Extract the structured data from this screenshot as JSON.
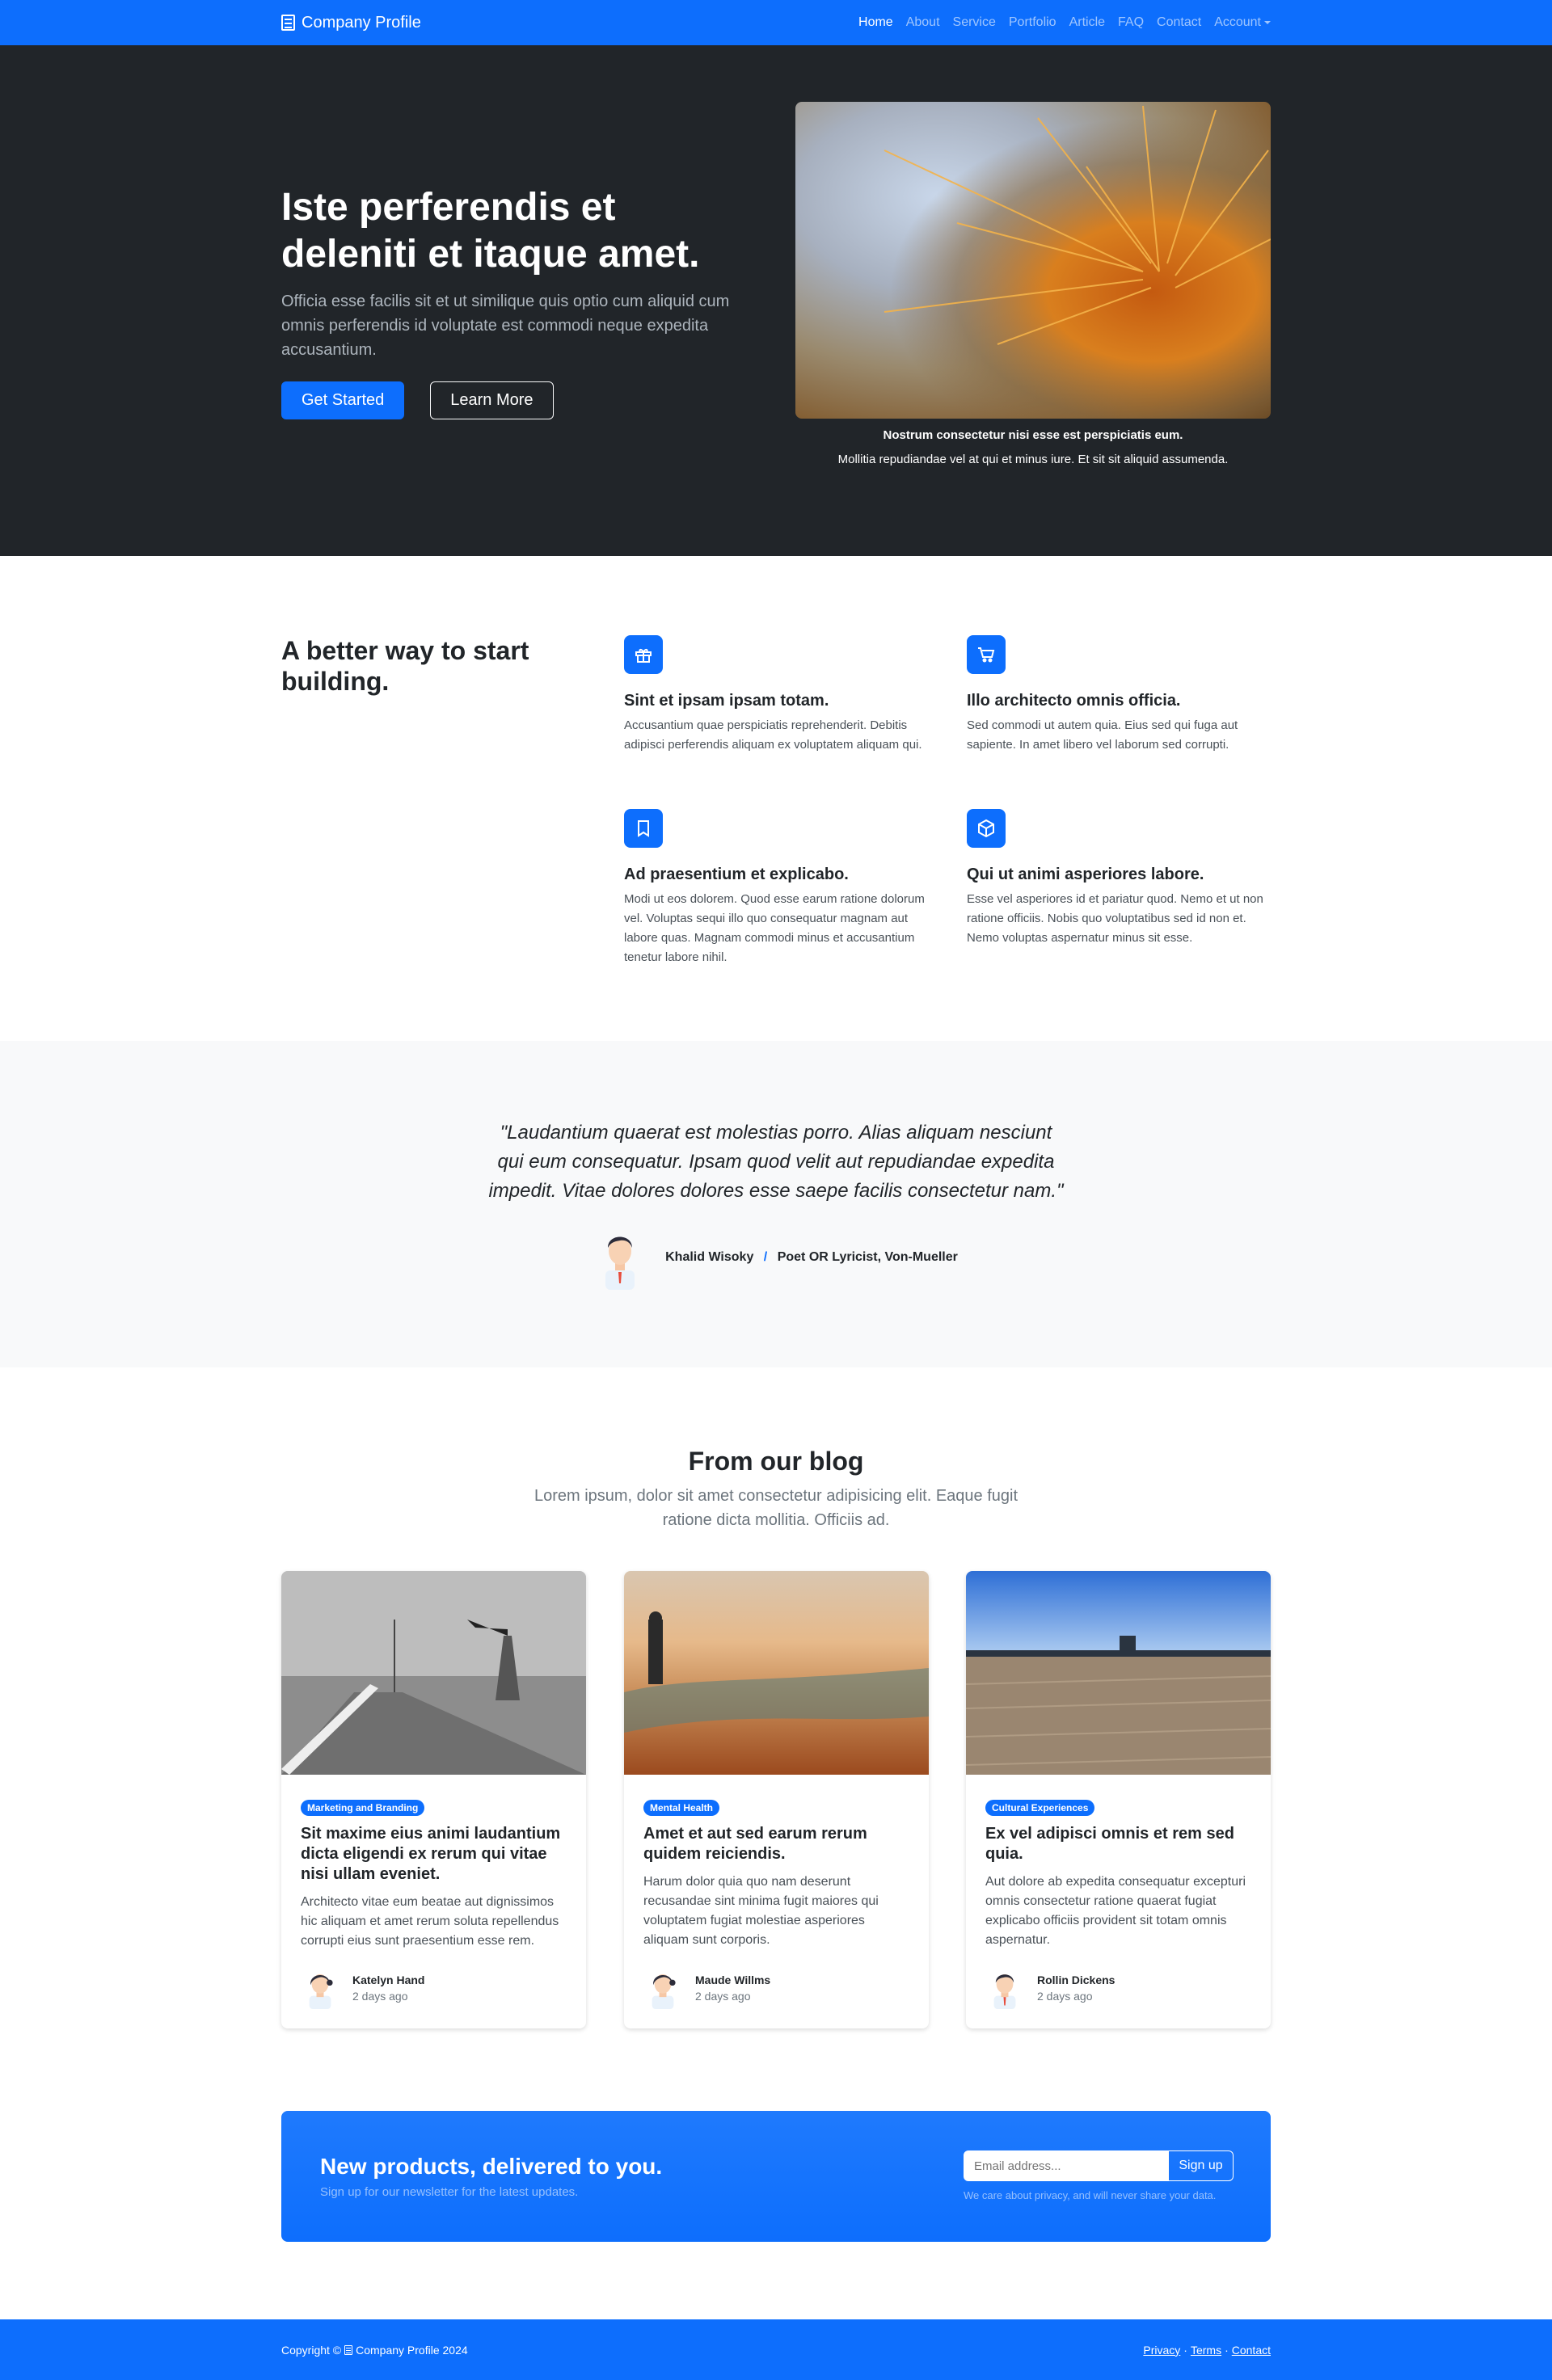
{
  "nav": {
    "brand": "Company Profile",
    "items": [
      {
        "label": "Home",
        "active": true
      },
      {
        "label": "About"
      },
      {
        "label": "Service"
      },
      {
        "label": "Portfolio"
      },
      {
        "label": "Article"
      },
      {
        "label": "FAQ"
      },
      {
        "label": "Contact"
      },
      {
        "label": "Account",
        "dropdown": true
      }
    ]
  },
  "hero": {
    "title_line1": "Iste perferendis et",
    "title_line2": "deleniti et itaque amet.",
    "lead": "Officia esse facilis sit et ut similique quis optio cum aliquid cum omnis perferendis id voluptate est commodi neque expedita accusantium.",
    "primary_button": "Get Started",
    "secondary_button": "Learn More",
    "carousel": {
      "caption_title": "Nostrum consectetur nisi esse est perspiciatis eum.",
      "caption_text": "Mollitia repudiandae vel at qui et minus iure. Et sit sit aliquid assumenda.",
      "slide_count": 5,
      "active_slide": 3
    }
  },
  "features": {
    "title": "A better way to start building.",
    "items": [
      {
        "icon": "gift-icon",
        "title": "Sint et ipsam ipsam totam.",
        "text": "Accusantium quae perspiciatis reprehenderit. Debitis adipisci perferendis aliquam ex voluptatem aliquam qui."
      },
      {
        "icon": "cart-icon",
        "title": "Illo architecto omnis officia.",
        "text": "Sed commodi ut autem quia. Eius sed qui fuga aut sapiente. In amet libero vel laborum sed corrupti."
      },
      {
        "icon": "bookmark-icon",
        "title": "Ad praesentium et explicabo.",
        "text": "Modi ut eos dolorem. Quod esse earum ratione dolorum vel. Voluptas sequi illo quo consequatur magnam aut labore quas. Magnam commodi minus et accusantium tenetur labore nihil."
      },
      {
        "icon": "box-icon",
        "title": "Qui ut animi asperiores labore.",
        "text": "Esse vel asperiores id et pariatur quod. Nemo et ut non ratione officiis. Nobis quo voluptatibus sed id non et. Nemo voluptas aspernatur minus sit esse."
      }
    ]
  },
  "testimonial": {
    "quote_line1": "\"Laudantium quaerat est molestias porro. Alias aliquam nesciunt",
    "quote_line2": "qui eum consequatur. Ipsam quod velit aut repudiandae expedita",
    "quote_line3": "impedit. Vitae dolores dolores esse saepe facilis consectetur nam.\"",
    "author": "Khalid Wisoky",
    "separator": "/",
    "role": "Poet OR Lyricist, Von-Mueller"
  },
  "blog": {
    "title": "From our blog",
    "lead": "Lorem ipsum, dolor sit amet consectetur adipisicing elit. Eaque fugit ratione dicta mollitia. Officiis ad.",
    "posts": [
      {
        "badge": "Marketing and Branding",
        "title": "Sit maxime eius animi laudantium dicta eligendi ex rerum qui vitae nisi ullam eveniet.",
        "text": "Architecto vitae eum beatae aut dignissimos hic aliquam et amet rerum soluta repellendus corrupti eius sunt praesentium esse rem.",
        "author": "Katelyn Hand",
        "date": "2 days ago"
      },
      {
        "badge": "Mental Health",
        "title": "Amet et aut sed earum rerum quidem reiciendis.",
        "text": "Harum dolor quia quo nam deserunt recusandae sint minima fugit maiores qui voluptatem fugiat molestiae asperiores aliquam sunt corporis.",
        "author": "Maude Willms",
        "date": "2 days ago"
      },
      {
        "badge": "Cultural Experiences",
        "title": "Ex vel adipisci omnis et rem sed quia.",
        "text": "Aut dolore ab expedita consequatur excepturi omnis consectetur ratione quaerat fugiat explicabo officiis provident sit totam omnis aspernatur.",
        "author": "Rollin Dickens",
        "date": "2 days ago"
      }
    ]
  },
  "newsletter": {
    "title": "New products, delivered to you.",
    "subtitle": "Sign up for our newsletter for the latest updates.",
    "placeholder": "Email address...",
    "button": "Sign up",
    "note": "We care about privacy, and will never share your data."
  },
  "footer": {
    "copyright_prefix": "Copyright ©",
    "brand": "Company Profile 2024",
    "links": [
      "Privacy",
      "Terms",
      "Contact"
    ],
    "separator": "·"
  },
  "colors": {
    "primary": "#0d6efd",
    "dark": "#212529",
    "light": "#f8f9fa"
  }
}
